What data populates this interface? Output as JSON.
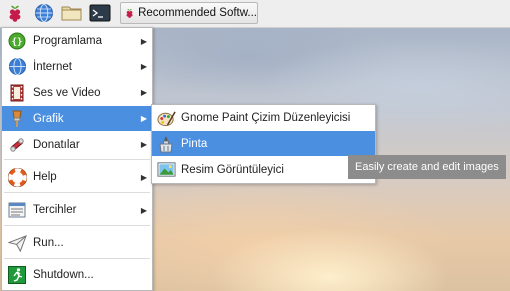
{
  "taskbar": {
    "task_label": "Recommended Softw..."
  },
  "main_menu": {
    "items": [
      {
        "label": "Programlama",
        "has_submenu": true
      },
      {
        "label": "İnternet",
        "has_submenu": true
      },
      {
        "label": "Ses ve Video",
        "has_submenu": true
      },
      {
        "label": "Grafik",
        "has_submenu": true,
        "selected": true
      },
      {
        "label": "Donatılar",
        "has_submenu": true
      },
      {
        "label": "Help",
        "has_submenu": true
      },
      {
        "label": "Tercihler",
        "has_submenu": true
      },
      {
        "label": "Run...",
        "has_submenu": false
      },
      {
        "label": "Shutdown...",
        "has_submenu": false
      }
    ]
  },
  "sub_menu": {
    "items": [
      {
        "label": "Gnome Paint Çizim Düzenleyicisi"
      },
      {
        "label": "Pinta",
        "selected": true
      },
      {
        "label": "Resim Görüntüleyici"
      }
    ]
  },
  "tooltip": {
    "text": "Easily create and edit images"
  },
  "colors": {
    "selection": "#4b8fe0",
    "tooltip_bg": "#8c8c8c",
    "raspberry": "#c51a4a"
  }
}
